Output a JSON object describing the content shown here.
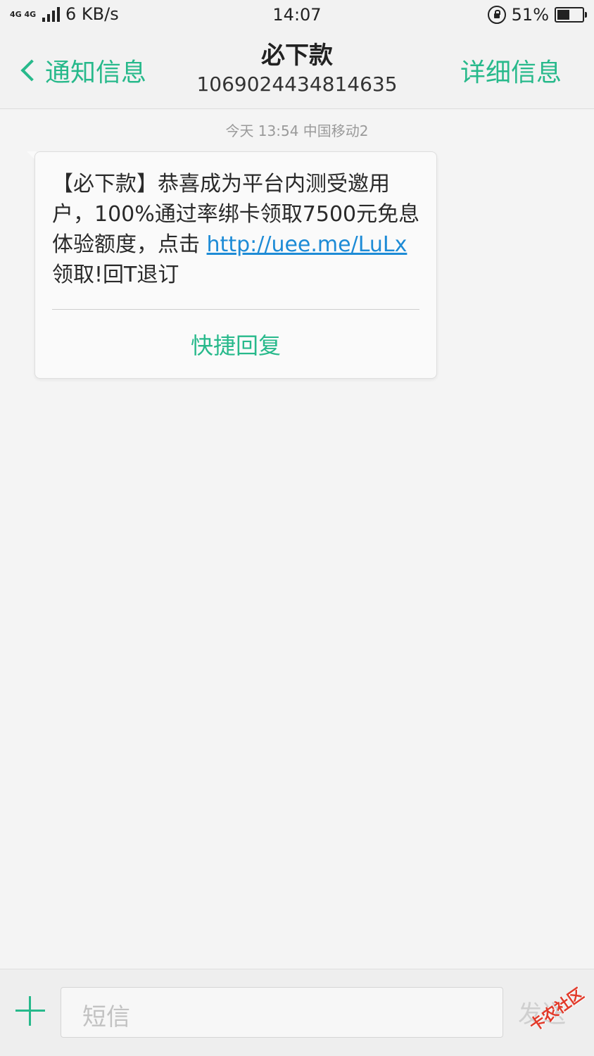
{
  "status_bar": {
    "signal_label": "4G 4G",
    "net_speed": "6 KB/s",
    "time": "14:07",
    "battery_pct": "51%",
    "battery_level": 0.51
  },
  "header": {
    "back_label": "通知信息",
    "title": "必下款",
    "subtitle": "1069024434814635",
    "detail_label": "详细信息"
  },
  "thread": {
    "timestamp": "今天 13:54  中国移动2",
    "message_text": "【必下款】恭喜成为平台内测受邀用户，100%通过率绑卡领取7500元免息体验额度，点击 ",
    "message_link": "http://uee.me/LuLx",
    "message_tail": "领取!回T退订",
    "quick_reply": "快捷回复"
  },
  "composer": {
    "placeholder": "短信",
    "send_label": "发送",
    "watermark": "卡农社区"
  },
  "colors": {
    "accent": "#27b98b",
    "link": "#1d8bd6"
  }
}
